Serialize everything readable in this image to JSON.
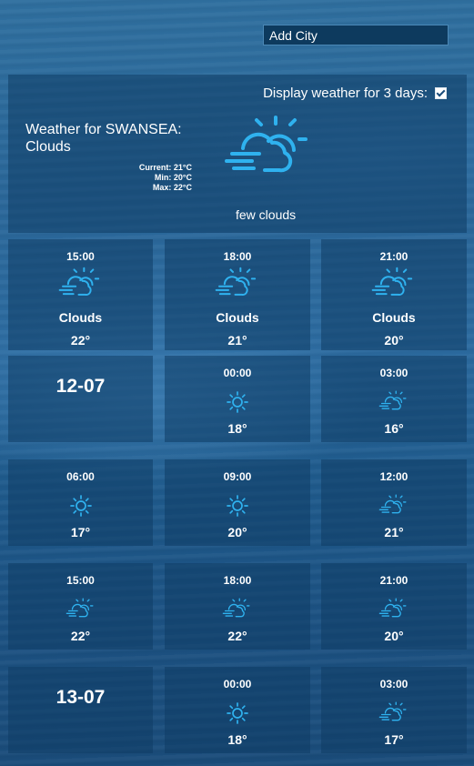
{
  "add_city": {
    "placeholder": "Add City"
  },
  "toggle": {
    "label": "Display weather for 3 days:",
    "checked": true
  },
  "current": {
    "title": "Weather for SWANSEA:",
    "condition": "Clouds",
    "current": "Current: 21°C",
    "min": "Min: 20°C",
    "max": "Max: 22°C",
    "icon": "cloud-sun-wind-icon",
    "description": "few clouds"
  },
  "today_cards": [
    {
      "time": "15:00",
      "icon": "cloud-sun-wind-icon",
      "condition": "Clouds",
      "temp": "22°"
    },
    {
      "time": "18:00",
      "icon": "cloud-sun-wind-icon",
      "condition": "Clouds",
      "temp": "21°"
    },
    {
      "time": "21:00",
      "icon": "cloud-sun-wind-icon",
      "condition": "Clouds",
      "temp": "20°"
    }
  ],
  "forecast": {
    "day1": {
      "date": "12-07",
      "slots": [
        {
          "time": "00:00",
          "icon": "sun-icon",
          "temp": "18°"
        },
        {
          "time": "03:00",
          "icon": "cloud-sun-wind-icon",
          "temp": "16°"
        },
        {
          "time": "06:00",
          "icon": "sun-icon",
          "temp": "17°"
        },
        {
          "time": "09:00",
          "icon": "sun-icon",
          "temp": "20°"
        },
        {
          "time": "12:00",
          "icon": "cloud-sun-wind-icon",
          "temp": "21°"
        },
        {
          "time": "15:00",
          "icon": "cloud-sun-wind-icon",
          "temp": "22°"
        },
        {
          "time": "18:00",
          "icon": "cloud-sun-wind-icon",
          "temp": "22°"
        },
        {
          "time": "21:00",
          "icon": "cloud-sun-wind-icon",
          "temp": "20°"
        }
      ]
    },
    "day2": {
      "date": "13-07",
      "slots": [
        {
          "time": "00:00",
          "icon": "sun-icon",
          "temp": "18°"
        },
        {
          "time": "03:00",
          "icon": "cloud-sun-wind-icon",
          "temp": "17°"
        }
      ]
    }
  },
  "colors": {
    "icon": "#2fb2ef",
    "card_bg": "#0e3c64",
    "accent_input": "#0d3a5e"
  }
}
